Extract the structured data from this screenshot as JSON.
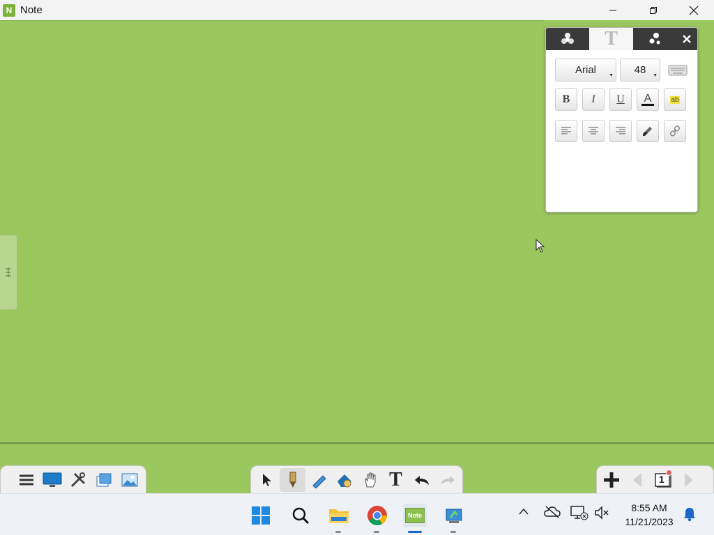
{
  "window": {
    "app_icon_letter": "N",
    "title": "Note"
  },
  "panel": {
    "tabs": [
      "properties-tab",
      "text-tab",
      "effects-tab"
    ],
    "font_family": "Arial",
    "font_size": "48",
    "bold": "B",
    "italic": "I",
    "underline": "U",
    "text_color_glyph": "A",
    "highlight_glyph": "ab",
    "text_tab_glyph": "T"
  },
  "toolbar": {
    "text_tool_glyph": "T"
  },
  "taskbar": {
    "time": "8:55 AM",
    "date": "11/21/2023",
    "note_app_label": "Note",
    "page_number": "1"
  },
  "colors": {
    "canvas": "#9bc75f",
    "panel_header": "#3a3a3a",
    "accent": "#1a66c9"
  }
}
